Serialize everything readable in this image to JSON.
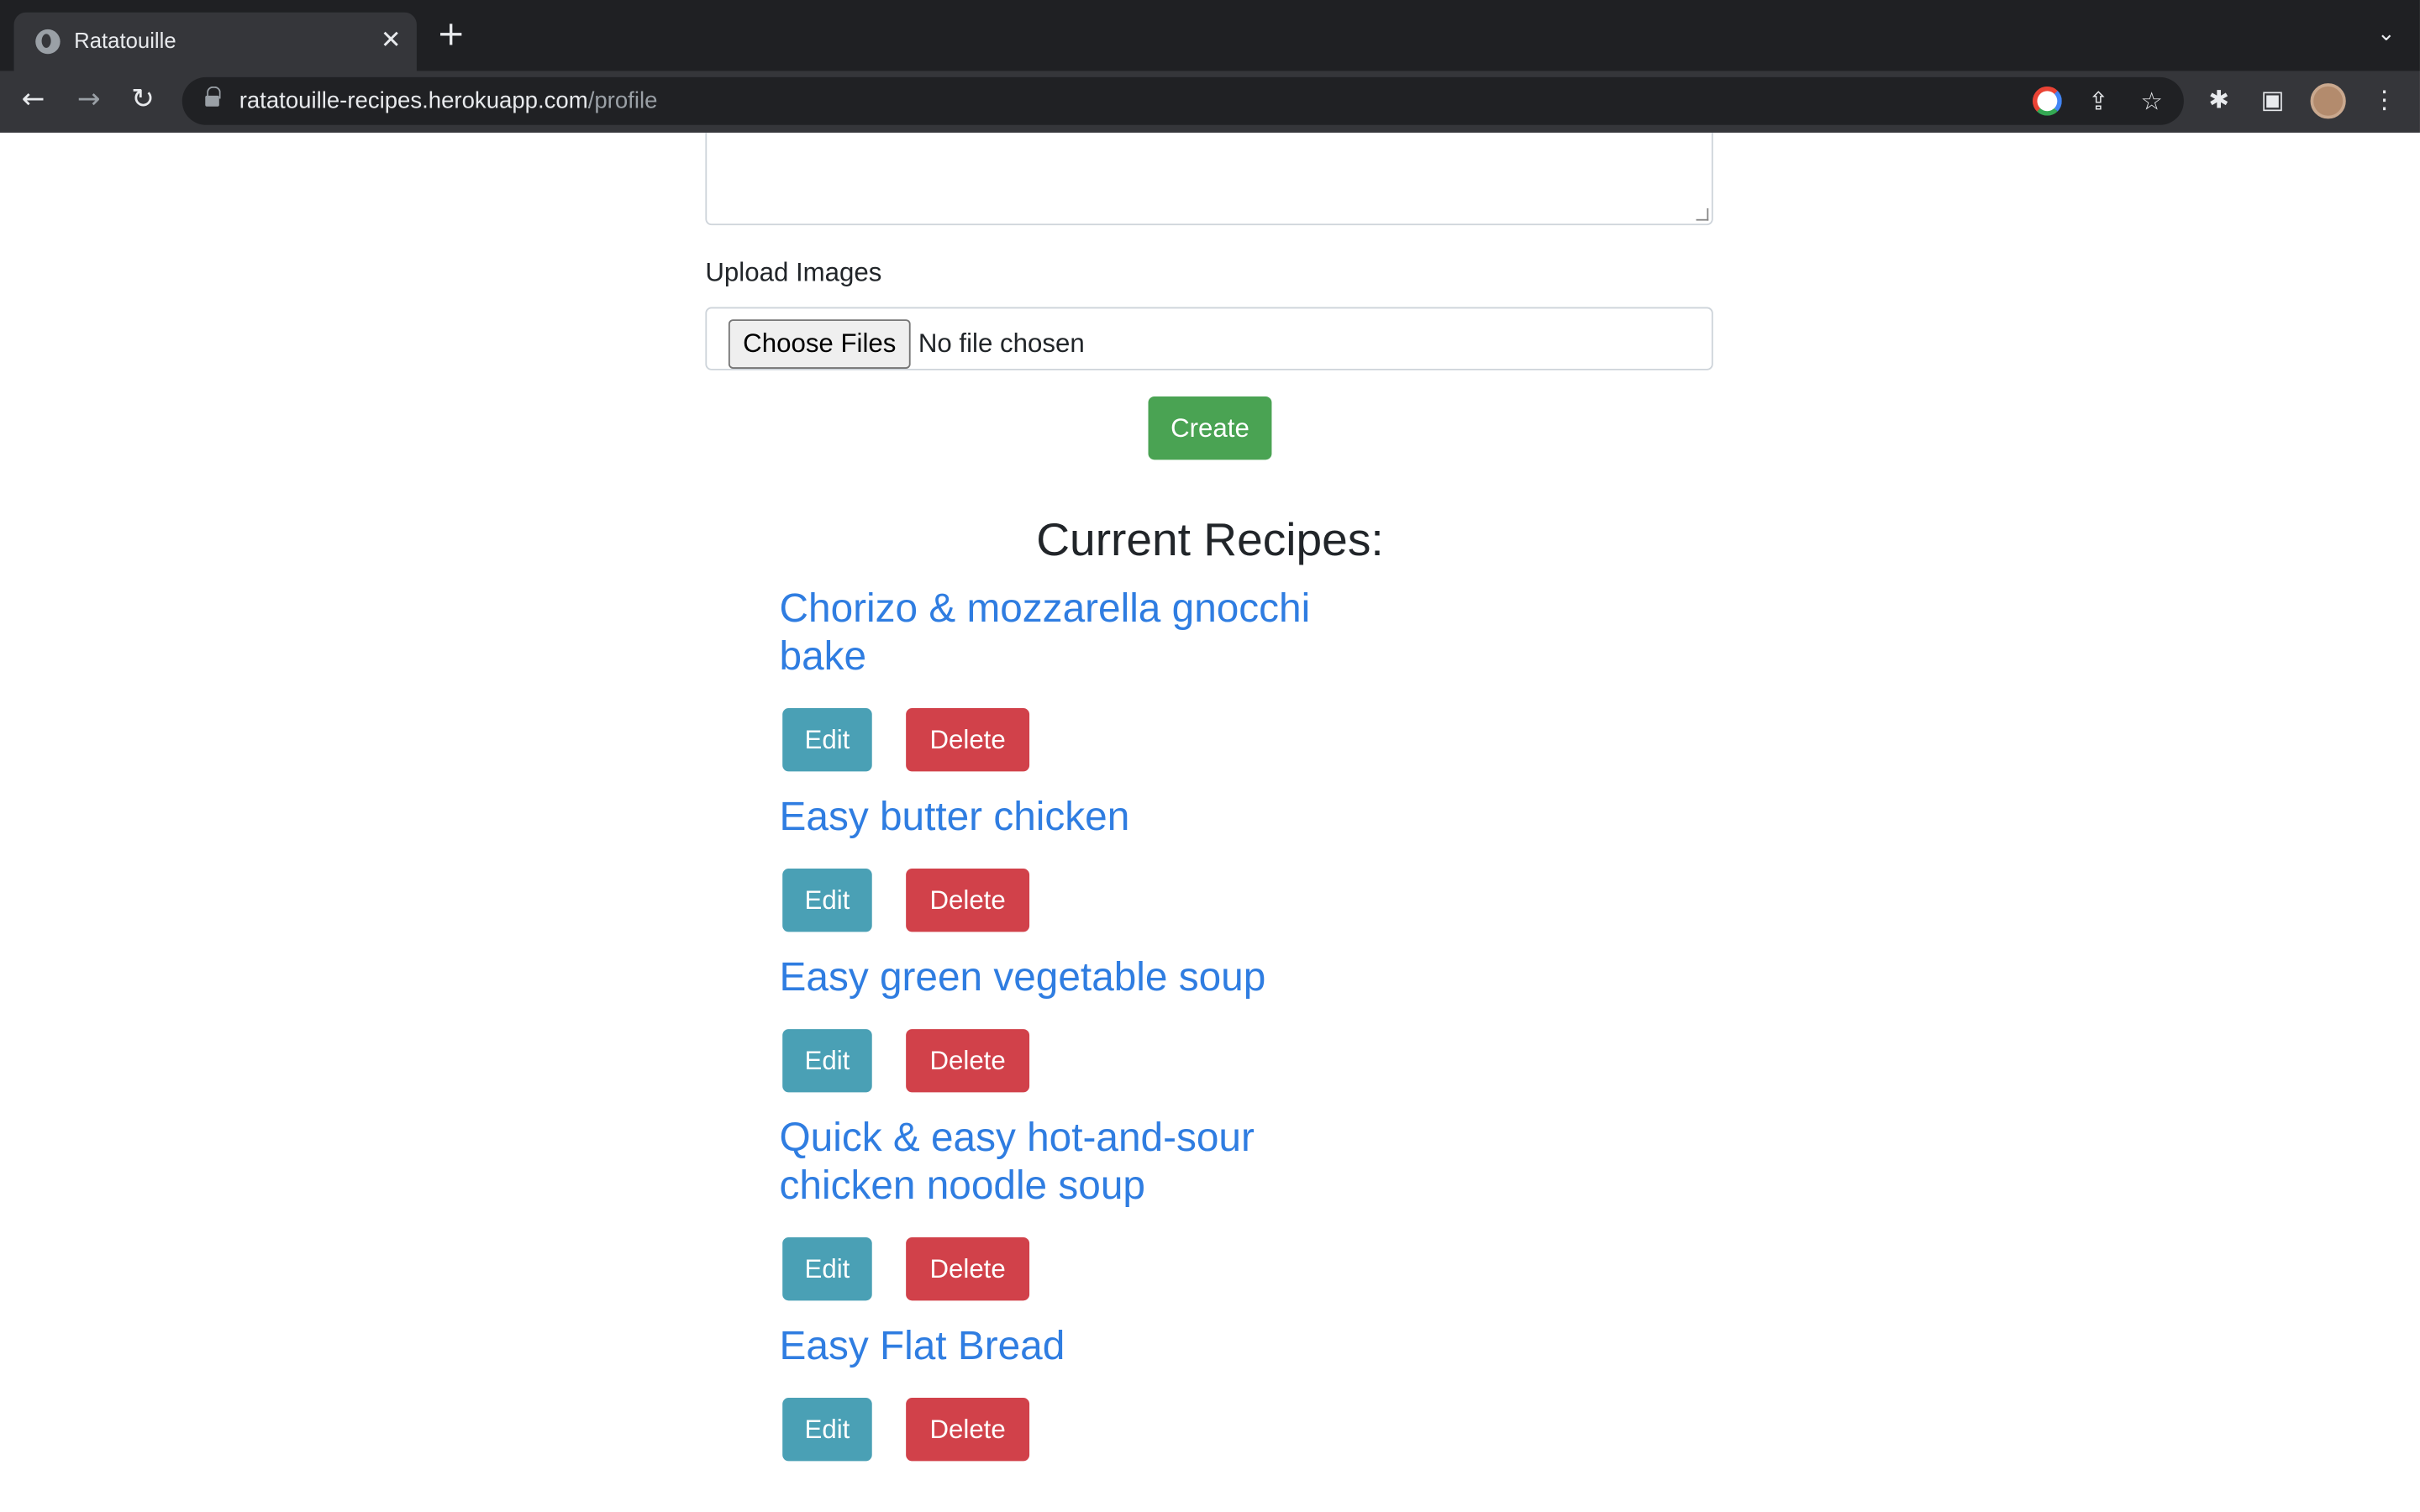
{
  "browser": {
    "tab_title": "Ratatouille",
    "tab_close": "✕",
    "new_tab": "+",
    "tab_menu": "⌄",
    "url_host": "ratatouille-recipes.herokuapp.com",
    "url_path": "/profile",
    "back": "←",
    "forward": "→",
    "reload": "↻",
    "share": "⇪",
    "star": "☆",
    "extensions": "✱",
    "sidepanel": "▣",
    "menu": "⋮"
  },
  "form": {
    "upload_label": "Upload Images",
    "choose_files": "Choose Files",
    "no_file": "No file chosen",
    "create_button": "Create"
  },
  "recipes": {
    "heading": "Current Recipes:",
    "edit_label": "Edit",
    "delete_label": "Delete",
    "items": [
      {
        "title": "Chorizo & mozzarella gnocchi bake"
      },
      {
        "title": "Easy butter chicken"
      },
      {
        "title": "Easy green vegetable soup"
      },
      {
        "title": "Quick & easy hot-and-sour chicken noodle soup"
      },
      {
        "title": "Easy Flat Bread"
      }
    ]
  },
  "colors": {
    "create": "#4aa353",
    "edit": "#4aa0b5",
    "delete": "#d1414a",
    "link": "#2f7de1"
  }
}
